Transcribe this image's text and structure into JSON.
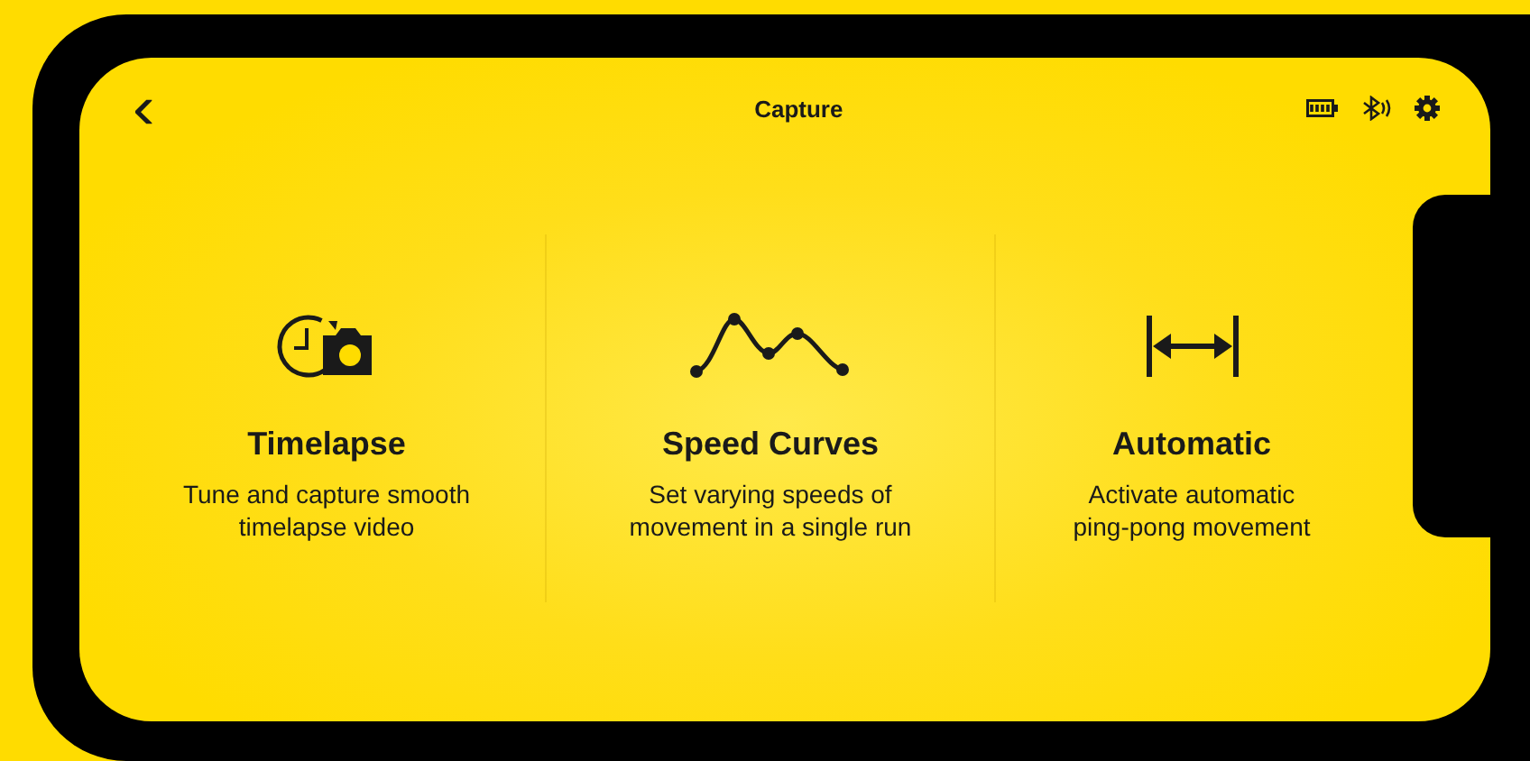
{
  "header": {
    "back": "‹",
    "title": "Capture"
  },
  "features": [
    {
      "kind": "timelapse",
      "title": "Timelapse",
      "description": "Tune and capture smooth\ntimelapse video"
    },
    {
      "kind": "curves",
      "title": "Speed Curves",
      "description": "Set varying speeds of\nmovement in a single run"
    },
    {
      "kind": "automatic",
      "title": "Automatic",
      "description": "Activate automatic\nping-pong movement"
    }
  ]
}
